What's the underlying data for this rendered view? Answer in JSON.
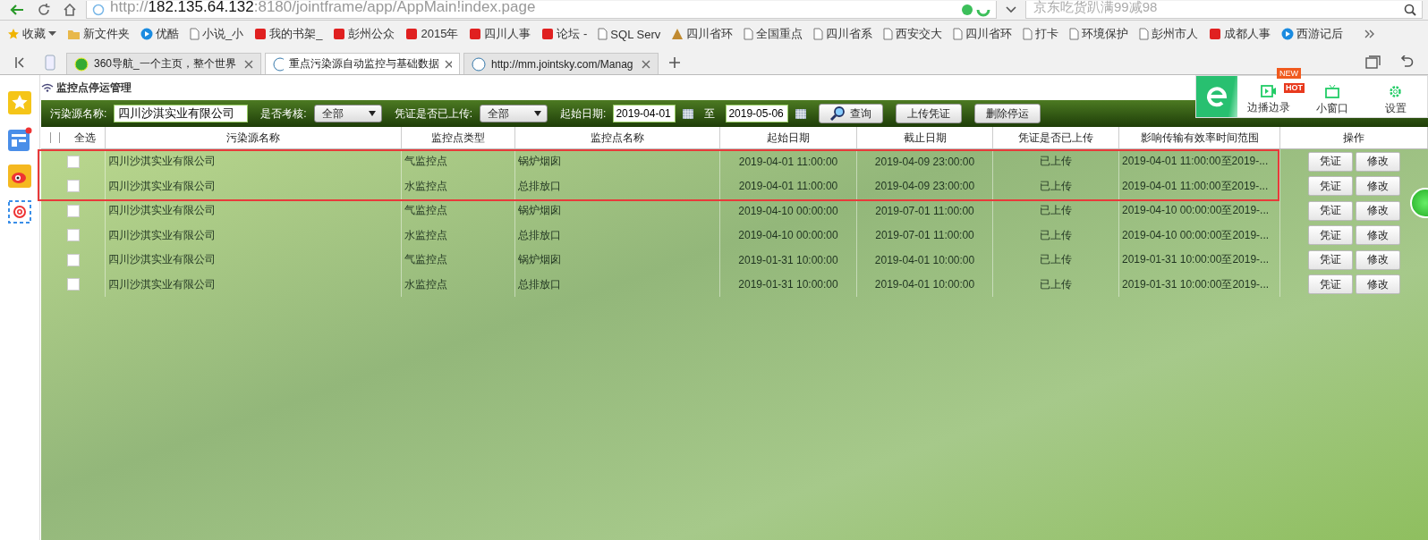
{
  "browser": {
    "url_scheme": "http://",
    "url_host": "182.135.64.132",
    "url_path": ":8180/jointframe/app/AppMain!index.page",
    "search_placeholder": "京东吃货趴满99减98"
  },
  "bookmarks": [
    {
      "label": "收藏",
      "kind": "star"
    },
    {
      "label": "新文件夹",
      "kind": "folder"
    },
    {
      "label": "优酷",
      "kind": "play"
    },
    {
      "label": "小说_小",
      "kind": "page"
    },
    {
      "label": "我的书架_",
      "kind": "red"
    },
    {
      "label": "彭州公众",
      "kind": "red"
    },
    {
      "label": "2015年",
      "kind": "red"
    },
    {
      "label": "四川人事",
      "kind": "red"
    },
    {
      "label": "论坛 -",
      "kind": "red"
    },
    {
      "label": "SQL Serv",
      "kind": "page"
    },
    {
      "label": "四川省环",
      "kind": "logo"
    },
    {
      "label": "全国重点",
      "kind": "page"
    },
    {
      "label": "四川省系",
      "kind": "page"
    },
    {
      "label": "西安交大",
      "kind": "page"
    },
    {
      "label": "四川省环",
      "kind": "page"
    },
    {
      "label": "打卡",
      "kind": "page"
    },
    {
      "label": "环境保护",
      "kind": "page"
    },
    {
      "label": "彭州市人",
      "kind": "page"
    },
    {
      "label": "成都人事",
      "kind": "red"
    },
    {
      "label": "西游记后",
      "kind": "play"
    }
  ],
  "tabs": [
    {
      "title": "360导航_一个主页，整个世界",
      "selected": false
    },
    {
      "title": "重点污染源自动监控与基础数据",
      "selected": true
    },
    {
      "title": "http://mm.jointsky.com/Manag",
      "selected": false
    }
  ],
  "page_title": "监控点停运管理",
  "filters": {
    "source_label": "污染源名称:",
    "source_value": "四川沙淇实业有限公司",
    "assess_label": "是否考核:",
    "assess_value": "全部",
    "uploaded_label": "凭证是否已上传:",
    "uploaded_value": "全部",
    "start_label": "起始日期:",
    "start_value": "2019-04-01",
    "to_label": "至",
    "end_value": "2019-05-06",
    "buttons": [
      "查询",
      "上传凭证",
      "删除停运"
    ]
  },
  "table": {
    "select_all": {
      "label": "全选",
      "checked": false
    },
    "columns": [
      "污染源名称",
      "监控点类型",
      "监控点名称",
      "起始日期",
      "截止日期",
      "凭证是否已上传",
      "影响传输有效率时间范围",
      "操作"
    ],
    "rows": [
      {
        "checked": false,
        "source": "四川沙淇实业有限公司",
        "type": "气监控点",
        "point": "锅炉烟囱",
        "start": "2019-04-01 11:00:00",
        "end": "2019-04-09 23:00:00",
        "uploaded": "已上传",
        "range": "2019-04-01 11:00:00至2019-...",
        "actions": [
          "凭证",
          "修改"
        ]
      },
      {
        "checked": false,
        "source": "四川沙淇实业有限公司",
        "type": "水监控点",
        "point": "总排放口",
        "start": "2019-04-01 11:00:00",
        "end": "2019-04-09 23:00:00",
        "uploaded": "已上传",
        "range": "2019-04-01 11:00:00至2019-...",
        "actions": [
          "凭证",
          "修改"
        ]
      },
      {
        "checked": false,
        "source": "四川沙淇实业有限公司",
        "type": "气监控点",
        "point": "锅炉烟囱",
        "start": "2019-04-10 00:00:00",
        "end": "2019-07-01 11:00:00",
        "uploaded": "已上传",
        "range": "2019-04-10 00:00:00至2019-...",
        "actions": [
          "凭证",
          "修改"
        ]
      },
      {
        "checked": false,
        "source": "四川沙淇实业有限公司",
        "type": "水监控点",
        "point": "总排放口",
        "start": "2019-04-10 00:00:00",
        "end": "2019-07-01 11:00:00",
        "uploaded": "已上传",
        "range": "2019-04-10 00:00:00至2019-...",
        "actions": [
          "凭证",
          "修改"
        ]
      },
      {
        "checked": false,
        "source": "四川沙淇实业有限公司",
        "type": "气监控点",
        "point": "锅炉烟囱",
        "start": "2019-01-31 10:00:00",
        "end": "2019-04-01 10:00:00",
        "uploaded": "已上传",
        "range": "2019-01-31 10:00:00至2019-...",
        "actions": [
          "凭证",
          "修改"
        ]
      },
      {
        "checked": false,
        "source": "四川沙淇实业有限公司",
        "type": "水监控点",
        "point": "总排放口",
        "start": "2019-01-31 10:00:00",
        "end": "2019-04-01 10:00:00",
        "uploaded": "已上传",
        "range": "2019-01-31 10:00:00至2019-...",
        "actions": [
          "凭证",
          "修改"
        ]
      }
    ]
  },
  "widget": {
    "new_badge": "NEW",
    "hot_badge": "HOT",
    "items": [
      "边播边录",
      "小窗口",
      "设置"
    ]
  }
}
